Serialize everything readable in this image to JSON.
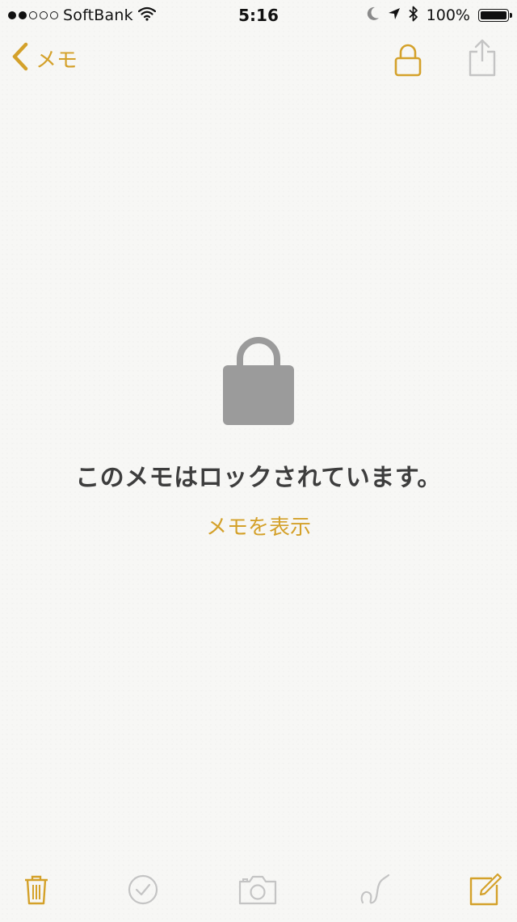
{
  "status_bar": {
    "carrier": "SoftBank",
    "time": "5:16",
    "battery_percent_label": "100%",
    "battery_level": 1.0,
    "signal_bars_filled": 2,
    "signal_bars_total": 5,
    "icons": [
      "wifi-icon",
      "moon-icon",
      "location-arrow-icon",
      "bluetooth-icon",
      "battery-icon"
    ]
  },
  "nav": {
    "back_label": "メモ",
    "icons": [
      "chevron-left-icon",
      "lock-icon",
      "share-icon"
    ]
  },
  "locked": {
    "message": "このメモはロックされています。",
    "view_button_label": "メモを表示",
    "icon": "lock-icon"
  },
  "toolbar": {
    "icons": [
      "trash-icon",
      "checklist-icon",
      "camera-icon",
      "sketch-icon",
      "compose-icon"
    ]
  },
  "colors": {
    "accent": "#d4a12a",
    "disabled": "#c4c4c4",
    "lock_fill": "#9b9b9b",
    "text": "#3d3d3d",
    "background": "#f7f7f5"
  }
}
